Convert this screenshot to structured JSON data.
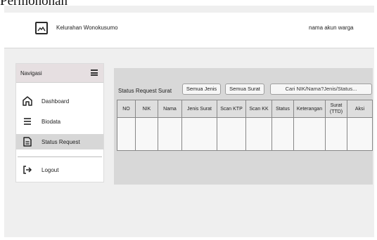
{
  "page_heading": "Permohonan",
  "header": {
    "brand": "Kelurahan Wonokusumo",
    "account": "nama akun warga",
    "logo_icon": "image-icon"
  },
  "sidebar": {
    "title": "Navigasi",
    "menu_icon": "hamburger-menu-icon",
    "items": [
      {
        "label": "Dashboard",
        "icon": "home-icon"
      },
      {
        "label": "Biodata",
        "icon": "list-icon"
      },
      {
        "label": "Status Request",
        "icon": "document-icon",
        "active": true
      },
      {
        "label": "Logout",
        "icon": "logout-icon"
      }
    ]
  },
  "main": {
    "title": "Status Request Surat",
    "filters": {
      "jenis": "Semua Jenis",
      "surat": "Semua Surat"
    },
    "search_placeholder": "Cari NIK/Nama?Jenis/Status...",
    "table": {
      "columns": [
        "NO",
        "NIK",
        "Nama",
        "Jenis Surat",
        "Scan KTP",
        "Scan KK",
        "Status",
        "Keterangan",
        "Surat (TTD)",
        "Aksi"
      ],
      "rows": []
    }
  },
  "colors": {
    "frame_bg": "#efefef",
    "content_bg": "#d8d8d8",
    "nav_header_bg": "#e6dfe1",
    "active_item_bg": "#d7d7d7"
  }
}
